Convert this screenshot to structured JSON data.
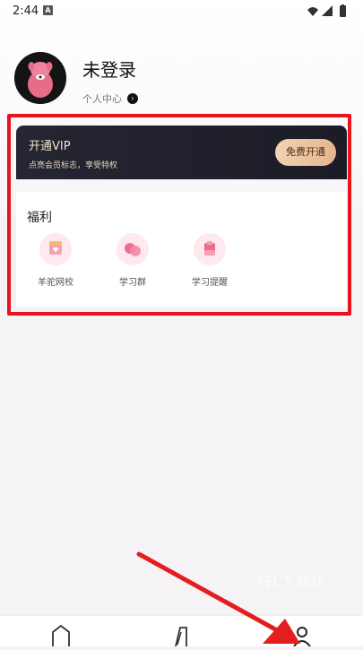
{
  "status": {
    "time": "2:44",
    "notif": "A"
  },
  "profile": {
    "name": "未登录",
    "center_link": "个人中心"
  },
  "vip": {
    "title": "开通VIP",
    "subtitle": "点亮会员标志，享受特权",
    "button": "免费开通"
  },
  "benefits": {
    "title": "福利",
    "items": [
      {
        "label": "羊驼网校",
        "icon": "school-icon"
      },
      {
        "label": "学习群",
        "icon": "group-icon"
      },
      {
        "label": "学习提醒",
        "icon": "reminder-icon"
      }
    ]
  },
  "watermark": "7日下载站",
  "tabbar": {
    "items": [
      "home-icon",
      "study-icon",
      "profile-icon"
    ]
  },
  "colors": {
    "highlight": "#e8131b",
    "vip_bg": "#262633",
    "vip_btn": "#e5b48c",
    "pink": "#f2708e"
  }
}
